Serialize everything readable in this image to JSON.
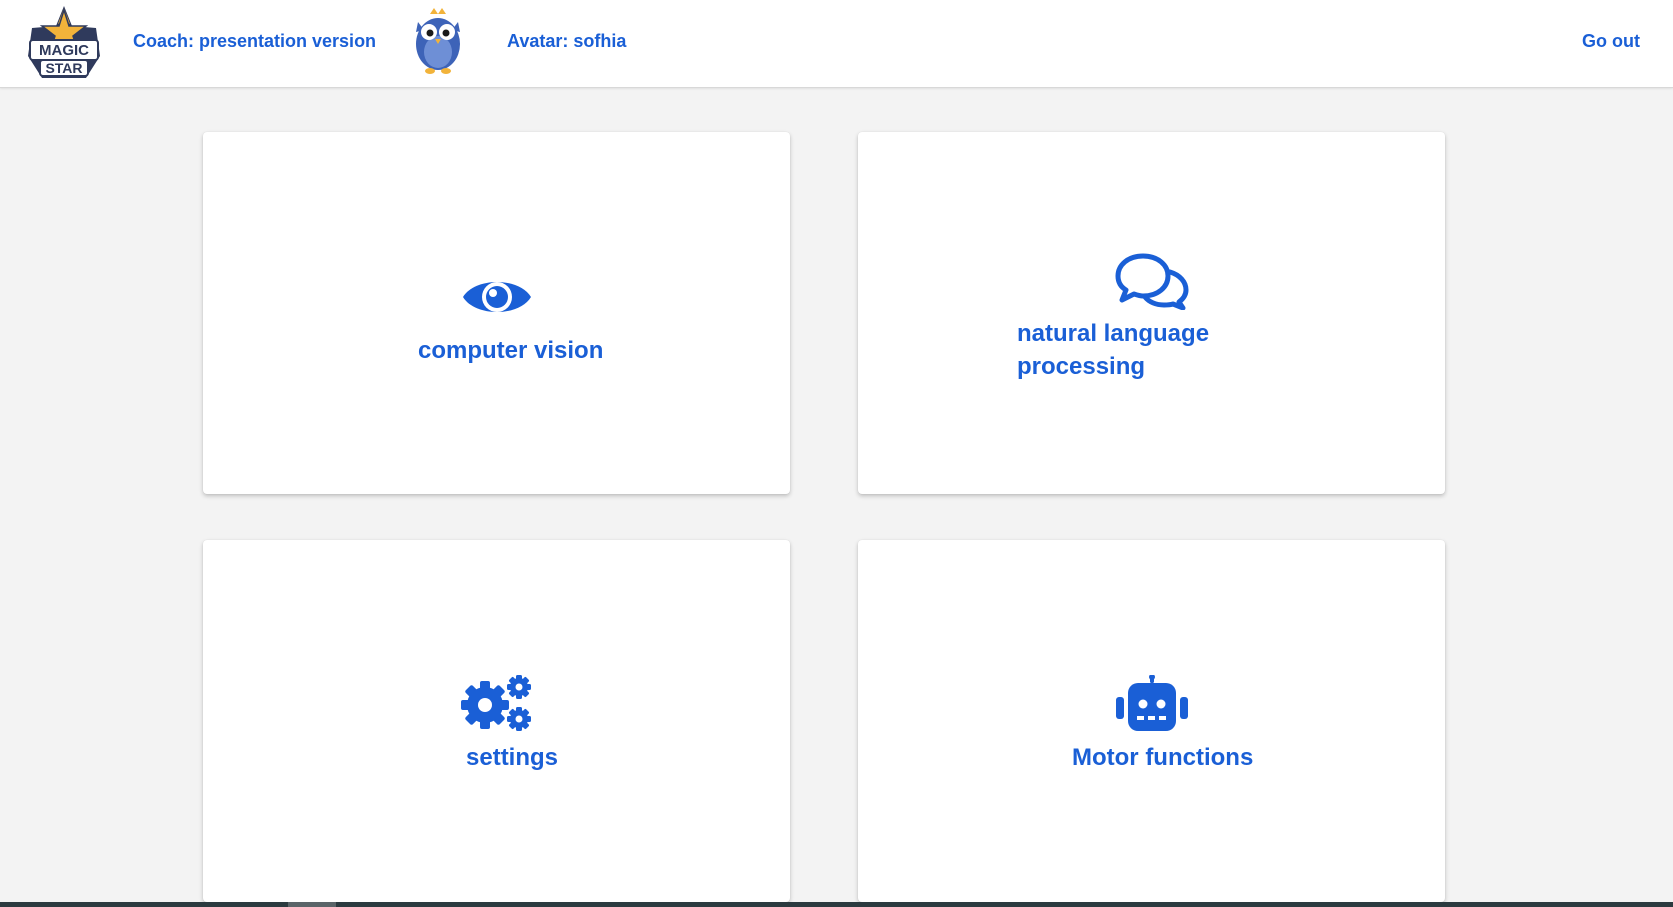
{
  "header": {
    "logo_text": "MAGIC STAR",
    "coach_label": "Coach: presentation version",
    "avatar_label": "Avatar: sofhia",
    "go_out_label": "Go out"
  },
  "cards": [
    {
      "label": "computer vision",
      "icon": "eye-icon"
    },
    {
      "label_line1": "natural language",
      "label_line2": "processing",
      "icon": "chat-bubbles-icon"
    },
    {
      "label": "settings",
      "icon": "gears-icon"
    },
    {
      "label": "Motor functions",
      "icon": "robot-icon"
    }
  ],
  "colors": {
    "accent": "#1a5fd6",
    "background": "#f3f3f3",
    "card": "#ffffff"
  }
}
